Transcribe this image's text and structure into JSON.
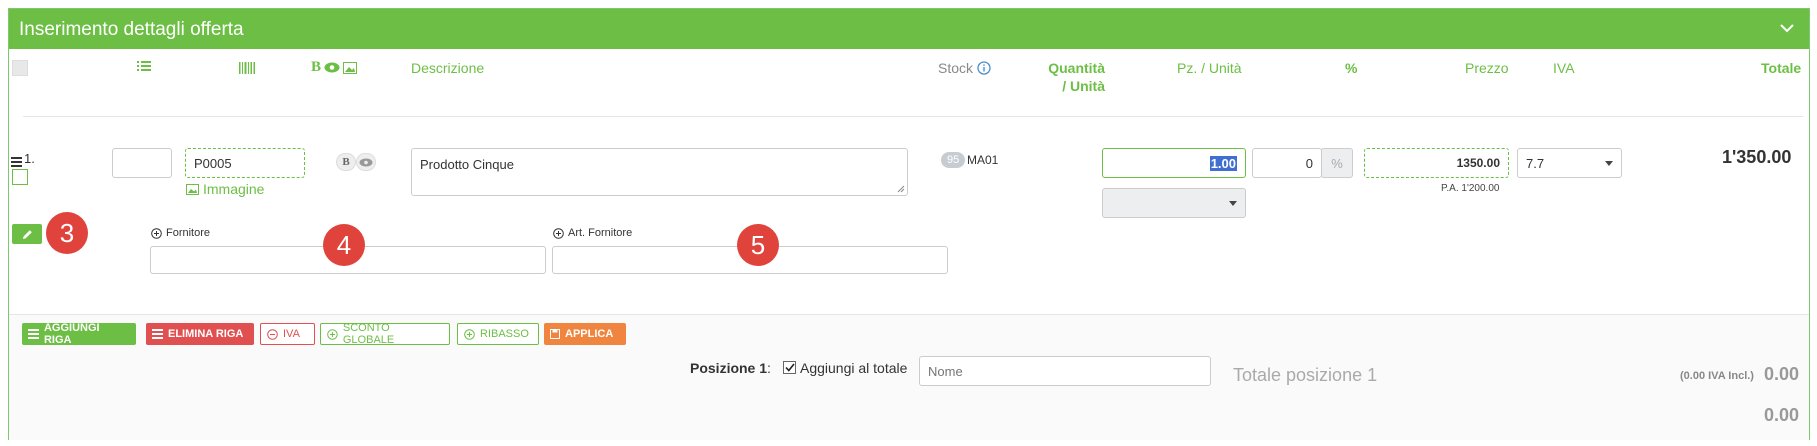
{
  "panel": {
    "title": "Inserimento dettagli offerta"
  },
  "headers": {
    "bold_icon": "B",
    "description": "Descrizione",
    "stock": "Stock",
    "qty_line1": "Quantità",
    "qty_line2": "/ Unità",
    "pcs": "Pz. / Unità",
    "pct": "%",
    "price": "Prezzo",
    "iva": "IVA",
    "total": "Totale"
  },
  "row": {
    "number": "1.",
    "code": "P0005",
    "image_link": "Immagine",
    "bold_toggle": "B",
    "description": "Prodotto Cinque",
    "stock_badge": "95",
    "stock_code": "MA01",
    "quantity": "1.00",
    "discount": "0",
    "pct_symbol": "%",
    "price": "1350.00",
    "purchase_price": "P.A. 1'200.00",
    "vat": "7.7",
    "total": "1'350.00",
    "supplier_label": "Fornitore",
    "supplier_article_label": "Art. Fornitore"
  },
  "markers": [
    "3",
    "4",
    "5"
  ],
  "buttons": {
    "add_row": "AGGIUNGI RIGA",
    "delete_row": "ELIMINA RIGA",
    "iva": "IVA",
    "global_discount": "SCONTO GLOBALE",
    "rebate": "RIBASSO",
    "apply": "APPLICA"
  },
  "footer": {
    "position_label": "Posizione 1",
    "colon": ":",
    "add_to_total": "Aggiungi al totale",
    "name_placeholder": "Nome",
    "position_total_label": "Totale posizione 1",
    "vat_incl": "(0.00 IVA Incl.)",
    "position_total": "0.00",
    "grand_total": "0.00"
  },
  "colors": {
    "accent": "#6cbf44",
    "danger": "#e05050",
    "warning": "#f08540",
    "marker": "#e0433c"
  }
}
